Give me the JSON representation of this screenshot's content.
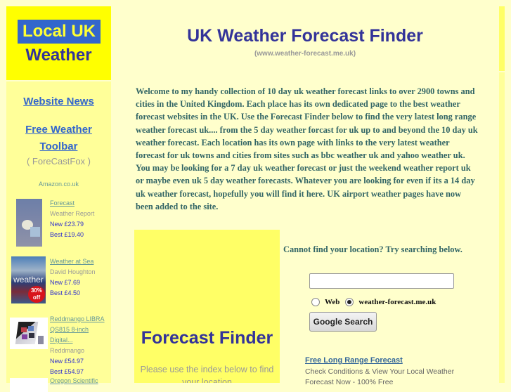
{
  "logo": {
    "line1": "Local UK",
    "line2": "Weather"
  },
  "header": {
    "title": "UK Weather Forecast Finder",
    "subtitle": "(www.weather-forecast.me.uk)"
  },
  "sidebar": {
    "links": [
      {
        "label": "Website News "
      },
      {
        "label": "Free Weather"
      },
      {
        "label": "Toolbar "
      }
    ],
    "toolbar_note": "( ForeCastFox )",
    "amazon_label": "Amazon.co.uk",
    "products": [
      {
        "title": "Forecast",
        "title_lines": [
          "Forecast"
        ],
        "author": "Weather Report",
        "new_price": "New £23.79",
        "best_price": "Best £19.40",
        "thumb_icon": "book-cover-icon"
      },
      {
        "title": "Weather at Sea",
        "title_lines": [
          "Weather at Sea"
        ],
        "author": "David Houghton",
        "new_price": "New £7.69",
        "best_price": "Best £4.50",
        "badge": "30% off",
        "thumb_icon": "book-cover-icon"
      },
      {
        "title": "Reddmango LIBRA QS815 8-inch Digital...",
        "title_lines": [
          "Reddmango LIBRA",
          "QS815 8-inch",
          "Digital..."
        ],
        "author": "Reddmango",
        "new_price": "New £54.97",
        "best_price": "Best £54.97",
        "thumb_icon": "photo-frame-icon"
      },
      {
        "title": "Oregon Scientific",
        "title_lines": [
          "Oregon Scientific"
        ],
        "thumb_icon": "product-icon"
      }
    ]
  },
  "intro": {
    "text": "Welcome to my handy collection of 10 day uk weather forecast links to over 2900 towns and cities in the United Kingdom. Each place has its own dedicated page to the best weather forecast websites in the UK. Use the Forecast Finder below to find the very latest long range weather forecast uk.... from the 5 day weather forcast for uk up to and beyond the 10 day uk weather forecast. Each location has its own page with links to the very latest weather forecast for uk towns and cities from sites such as bbc weather uk and yahoo weather uk. You may be looking for a 7 day uk weather forecast or just the weekend weather report uk or maybe even uk 5 day weather forecasts. Whatever you are looking for even if its a 14 day uk weather forecast, hopefully you will find it here. UK airport weather pages have now been added to the site."
  },
  "finder": {
    "title": "Forecast Finder",
    "note": "Please use the index below to find your location"
  },
  "search": {
    "prompt": "Cannot find your location? Try searching below.",
    "input_value": "",
    "radio_options": [
      {
        "label": "Web",
        "checked": false
      },
      {
        "label": "weather-forecast.me.uk",
        "checked": true
      }
    ],
    "button_label": "Google Search"
  },
  "ad": {
    "link_label": "Free Long Range Forecast",
    "text": "Check Conditions & View Your Local Weather Forecast Now - 100% Free"
  },
  "colors": {
    "page_bg": "#ffffcc",
    "logo_bg": "#ffff00",
    "logo_badge": "#3366cc",
    "heading": "#333399",
    "link": "#3366cc",
    "body_text": "#336666",
    "finder_bg": "#ffff66",
    "sidebar_bg": "#ffff99"
  }
}
